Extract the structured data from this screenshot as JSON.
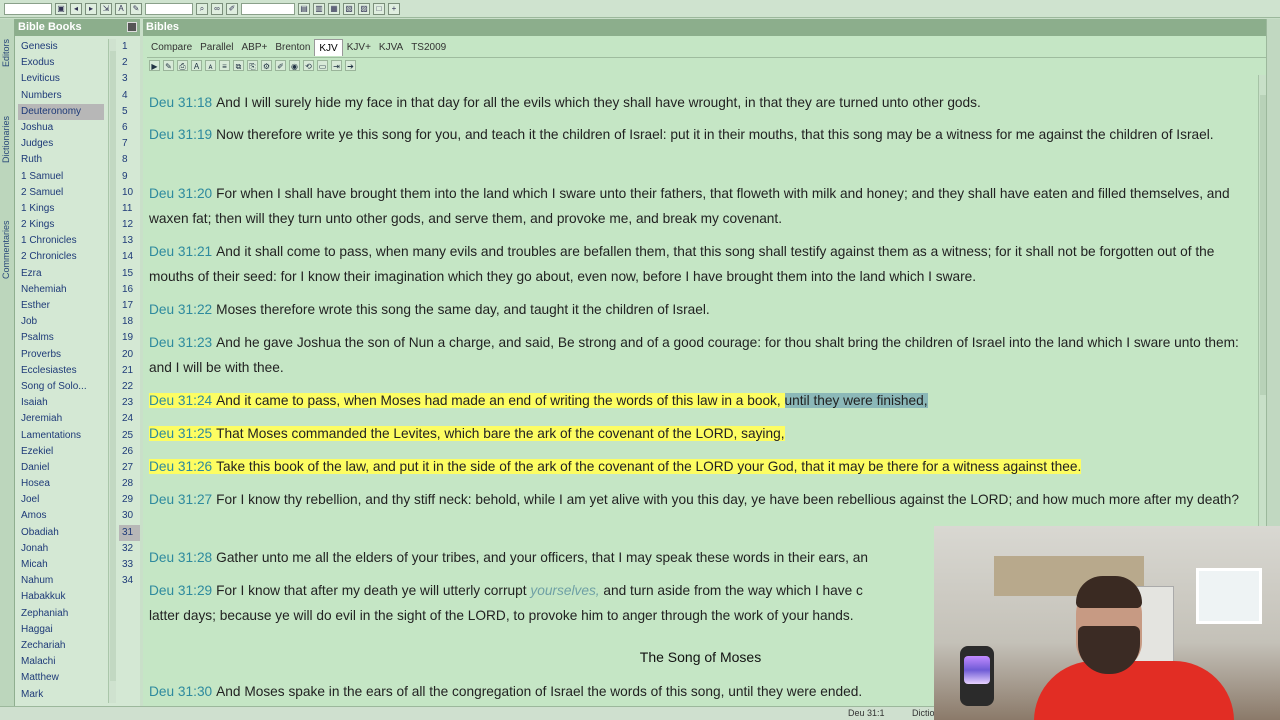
{
  "panels": {
    "books_title": "Bible Books",
    "bibles_title": "Bibles",
    "left_tabs": [
      "Editors",
      "Dictionaries",
      "Commentaries"
    ]
  },
  "books": [
    "Genesis",
    "Exodus",
    "Leviticus",
    "Numbers",
    "Deuteronomy",
    "Joshua",
    "Judges",
    "Ruth",
    "1 Samuel",
    "2 Samuel",
    "1 Kings",
    "2 Kings",
    "1 Chronicles",
    "2 Chronicles",
    "Ezra",
    "Nehemiah",
    "Esther",
    "Job",
    "Psalms",
    "Proverbs",
    "Ecclesiastes",
    "Song of Solo...",
    "Isaiah",
    "Jeremiah",
    "Lamentations",
    "Ezekiel",
    "Daniel",
    "Hosea",
    "Joel",
    "Amos",
    "Obadiah",
    "Jonah",
    "Micah",
    "Nahum",
    "Habakkuk",
    "Zephaniah",
    "Haggai",
    "Zechariah",
    "Malachi",
    "Matthew",
    "Mark"
  ],
  "selected_book_index": 4,
  "chapters": [
    "1",
    "2",
    "3",
    "4",
    "5",
    "6",
    "7",
    "8",
    "9",
    "10",
    "11",
    "12",
    "13",
    "14",
    "15",
    "16",
    "17",
    "18",
    "19",
    "20",
    "21",
    "22",
    "23",
    "24",
    "25",
    "26",
    "27",
    "28",
    "29",
    "30",
    "31",
    "32",
    "33",
    "34"
  ],
  "selected_chapter_index": 30,
  "tabs": [
    "Compare",
    "Parallel",
    "ABP+",
    "Brenton",
    "KJV",
    "KJV+",
    "KJVA",
    "TS2009"
  ],
  "active_tab_index": 4,
  "verses": [
    {
      "ref": "Deu 31:18",
      "text": "And I will surely hide my face in that day for all the evils which they shall have wrought, in that they are turned unto other gods."
    },
    {
      "ref": "Deu 31:19",
      "text": "Now therefore write ye this song for you, and teach it the children of Israel: put it in their mouths, that this song may be a witness for me against the children of Israel."
    },
    {
      "ref": "Deu 31:20",
      "text": "For when I shall have brought them into the land which I sware unto their fathers, that floweth with milk and honey; and they shall have eaten and filled themselves, and waxen fat; then will they turn unto other gods, and serve them, and provoke me, and break my covenant."
    },
    {
      "ref": "Deu 31:21",
      "text": "And it shall come to pass, when many evils and troubles are befallen them, that this song shall testify against them as a witness; for it shall not be forgotten out of the mouths of their seed: for I know their imagination which they go about, even now, before I have brought them into the land which I sware."
    },
    {
      "ref": "Deu 31:22",
      "text": "Moses therefore wrote this song the same day, and taught it the children of Israel."
    },
    {
      "ref": "Deu 31:23",
      "text": "And he gave Joshua the son of Nun a charge, and said, Be strong and of a good courage: for thou shalt bring the children of Israel into the land which I sware unto them: and I will be with thee."
    },
    {
      "ref": "Deu 31:24",
      "text_a": "And it came to pass, when Moses had made an end of writing the words of this law in a book,",
      "text_b": "until they were finished,"
    },
    {
      "ref": "Deu 31:25",
      "text": "That Moses commanded the Levites, which bare the ark of the covenant of the LORD, saying,"
    },
    {
      "ref": "Deu 31:26",
      "text": "Take this book of the law, and put it in the side of the ark of the covenant of the LORD your God, that it may be there for a witness against thee."
    },
    {
      "ref": "Deu 31:27",
      "text": "For I know thy rebellion, and thy stiff neck: behold, while I am yet alive with you this day, ye have been rebellious against the LORD; and how much more after my death?"
    },
    {
      "ref": "Deu 31:28",
      "text": "Gather unto me all the elders of your tribes, and your officers, that I may speak these words in their ears, an"
    },
    {
      "ref": "Deu 31:29",
      "text_a": "For I know that after my death ye will utterly corrupt",
      "ital": "yourselves,",
      "text_b": "and turn aside from the way which I have c",
      "text_c": "latter days; because ye will do evil in the sight of the LORD, to provoke him to anger through the work of your hands."
    },
    {
      "ref": "Deu 31:30",
      "text": "And Moses spake in the ears of all the congregation of Israel the words of this song, until they were ended."
    }
  ],
  "heading": "The Song of Moses",
  "status": {
    "ref": "Deu 31:1",
    "label": "Dictio"
  }
}
